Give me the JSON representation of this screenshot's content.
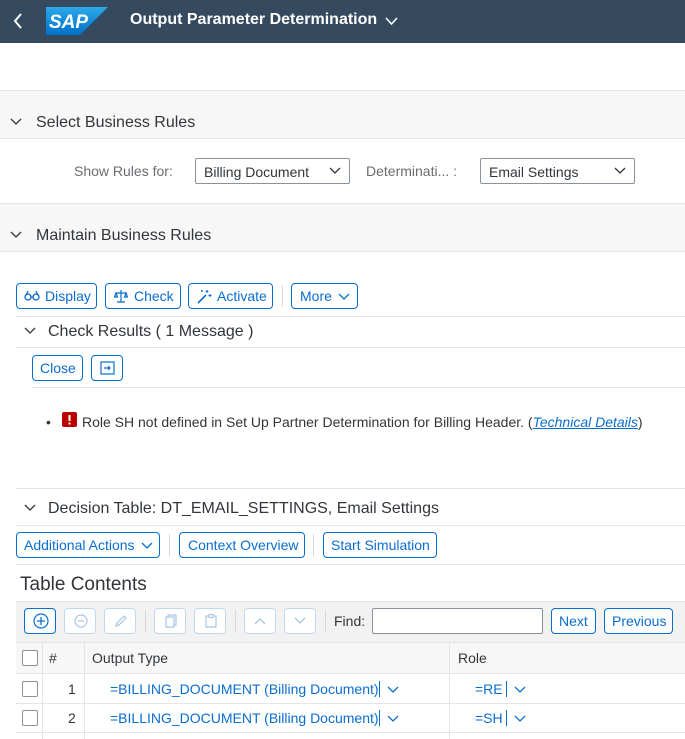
{
  "shell": {
    "back_icon": "chevron-left-icon",
    "logo": "SAP",
    "title": "Output Parameter Determination",
    "title_menu_icon": "chevron-down-icon"
  },
  "select_rules": {
    "title": "Select Business Rules",
    "show_rules_label": "Show Rules for:",
    "show_rules_value": "Billing Document",
    "determination_label": "Determinati... :",
    "determination_value": "Email Settings"
  },
  "maintain_rules": {
    "title": "Maintain Business Rules",
    "toolbar": {
      "display": "Display",
      "check": "Check",
      "activate": "Activate",
      "more": "More"
    }
  },
  "check_results": {
    "title": "Check Results ( 1 Message )",
    "close": "Close",
    "message": "Role SH not defined in Set Up Partner Determination for Billing Header.",
    "message_paren_open": "(",
    "technical_details": "Technical Details",
    "message_paren_close": ")",
    "error_icon": "error-icon"
  },
  "decision_table": {
    "title": "Decision Table: DT_EMAIL_SETTINGS, Email Settings",
    "additional_actions": "Additional Actions",
    "context_overview": "Context Overview",
    "start_simulation": "Start Simulation"
  },
  "table_contents": {
    "title": "Table Contents",
    "find_label": "Find:",
    "find_value": "",
    "next": "Next",
    "previous": "Previous",
    "columns": [
      "#",
      "Output Type",
      "Role"
    ],
    "rows": [
      {
        "num": "1",
        "output_type": "=BILLING_DOCUMENT (Billing Document)",
        "role": "=RE"
      },
      {
        "num": "2",
        "output_type": "=BILLING_DOCUMENT (Billing Document)",
        "role": "=SH"
      }
    ]
  },
  "colors": {
    "shell_bg": "#354a5f",
    "accent": "#0a6ed1",
    "error": "#bb0000"
  }
}
